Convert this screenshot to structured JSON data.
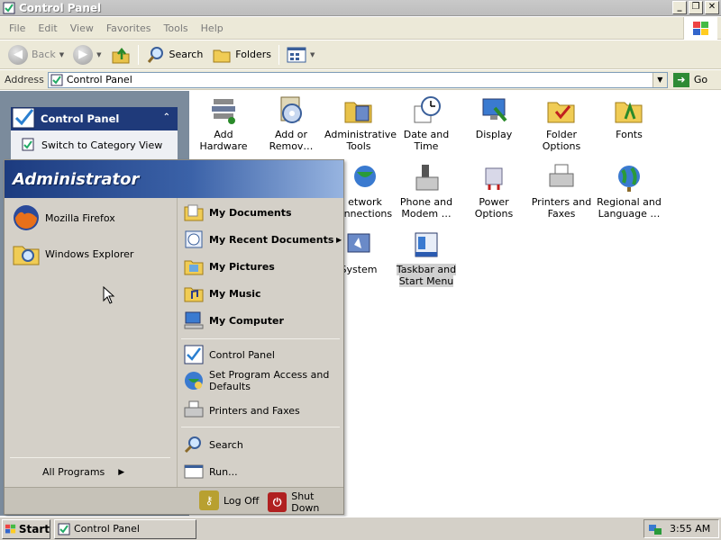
{
  "window": {
    "title": "Control Panel"
  },
  "menubar": {
    "items": [
      "File",
      "Edit",
      "View",
      "Favorites",
      "Tools",
      "Help"
    ]
  },
  "toolbar": {
    "back": "Back",
    "search": "Search",
    "folders": "Folders"
  },
  "address": {
    "label": "Address",
    "value": "Control Panel",
    "go": "Go"
  },
  "taskpane": {
    "title": "Control Panel",
    "link": "Switch to Category View"
  },
  "items": [
    {
      "label": "Add Hardware",
      "icon": "hardware-icon"
    },
    {
      "label": "Add or Remov…",
      "icon": "add-remove-icon"
    },
    {
      "label": "Administrative Tools",
      "icon": "admin-tools-icon"
    },
    {
      "label": "Date and Time",
      "icon": "clock-icon"
    },
    {
      "label": "Display",
      "icon": "display-icon"
    },
    {
      "label": "Folder Options",
      "icon": "folder-options-icon"
    },
    {
      "label": "Fonts",
      "icon": "fonts-icon"
    },
    {
      "label": "Network Connections",
      "icon": "network-icon",
      "visible": "etwork onnections"
    },
    {
      "label": "Phone and Modem …",
      "icon": "phone-icon"
    },
    {
      "label": "Power Options",
      "icon": "power-icon"
    },
    {
      "label": "Printers and Faxes",
      "icon": "printer-icon"
    },
    {
      "label": "Regional and Language …",
      "icon": "globe-icon"
    },
    {
      "label": "System",
      "icon": "system-icon"
    },
    {
      "label": "Taskbar and Start Menu",
      "icon": "taskbar-icon"
    }
  ],
  "startmenu": {
    "user": "Administrator",
    "pinned": [
      {
        "label": "Mozilla Firefox",
        "icon": "firefox-icon"
      },
      {
        "label": "Windows Explorer",
        "icon": "explorer-icon"
      }
    ],
    "all_programs": "All Programs",
    "places": [
      {
        "label": "My Documents",
        "icon": "documents-icon"
      },
      {
        "label": "My Recent Documents",
        "icon": "recent-icon"
      },
      {
        "label": "My Pictures",
        "icon": "pictures-icon"
      },
      {
        "label": "My Music",
        "icon": "music-icon"
      },
      {
        "label": "My Computer",
        "icon": "computer-icon"
      }
    ],
    "settings": [
      {
        "label": "Control Panel",
        "icon": "control-panel-icon"
      },
      {
        "label": "Set Program Access and Defaults",
        "icon": "defaults-icon"
      },
      {
        "label": "Printers and Faxes",
        "icon": "printer-icon"
      }
    ],
    "tools": [
      {
        "label": "Search",
        "icon": "search-icon"
      },
      {
        "label": "Run...",
        "icon": "run-icon"
      }
    ],
    "log_off": "Log Off",
    "shut_down": "Shut Down"
  },
  "taskbar": {
    "start": "Start",
    "task": "Control Panel",
    "clock": "3:55 AM"
  }
}
